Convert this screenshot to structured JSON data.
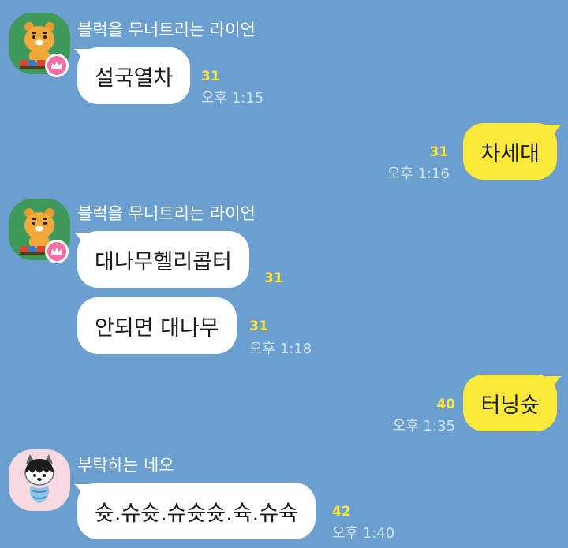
{
  "theme": {
    "background": "#6b9fd0",
    "incoming_bubble": "#ffffff",
    "outgoing_bubble": "#fde93a",
    "unread_color": "#fde93a",
    "crown_badge": "#f06fa5"
  },
  "messages": [
    {
      "id": "m1",
      "sender": "블럭을 무너트리는 라이언",
      "avatar": "ryan-character-icon",
      "text": "설국열차",
      "unread": "31",
      "time": "오후 1:15"
    },
    {
      "id": "m2",
      "outgoing": true,
      "text": "차세대",
      "unread": "31",
      "time": "오후 1:16"
    },
    {
      "id": "m3",
      "sender": "블럭을 무너트리는 라이언",
      "avatar": "ryan-character-icon",
      "text": "대나무헬리콥터",
      "unread": "31"
    },
    {
      "id": "m4",
      "text": "안되면 대나무",
      "unread": "31",
      "time": "오후 1:18"
    },
    {
      "id": "m5",
      "outgoing": true,
      "text": "터닝슛",
      "unread": "40",
      "time": "오후 1:35"
    },
    {
      "id": "m6",
      "sender": "부탁하는 네오",
      "avatar": "neo-character-icon",
      "text": "슛.슈슛.슈슛슛.슉.슈슉",
      "unread": "42",
      "time": "오후 1:40"
    }
  ]
}
